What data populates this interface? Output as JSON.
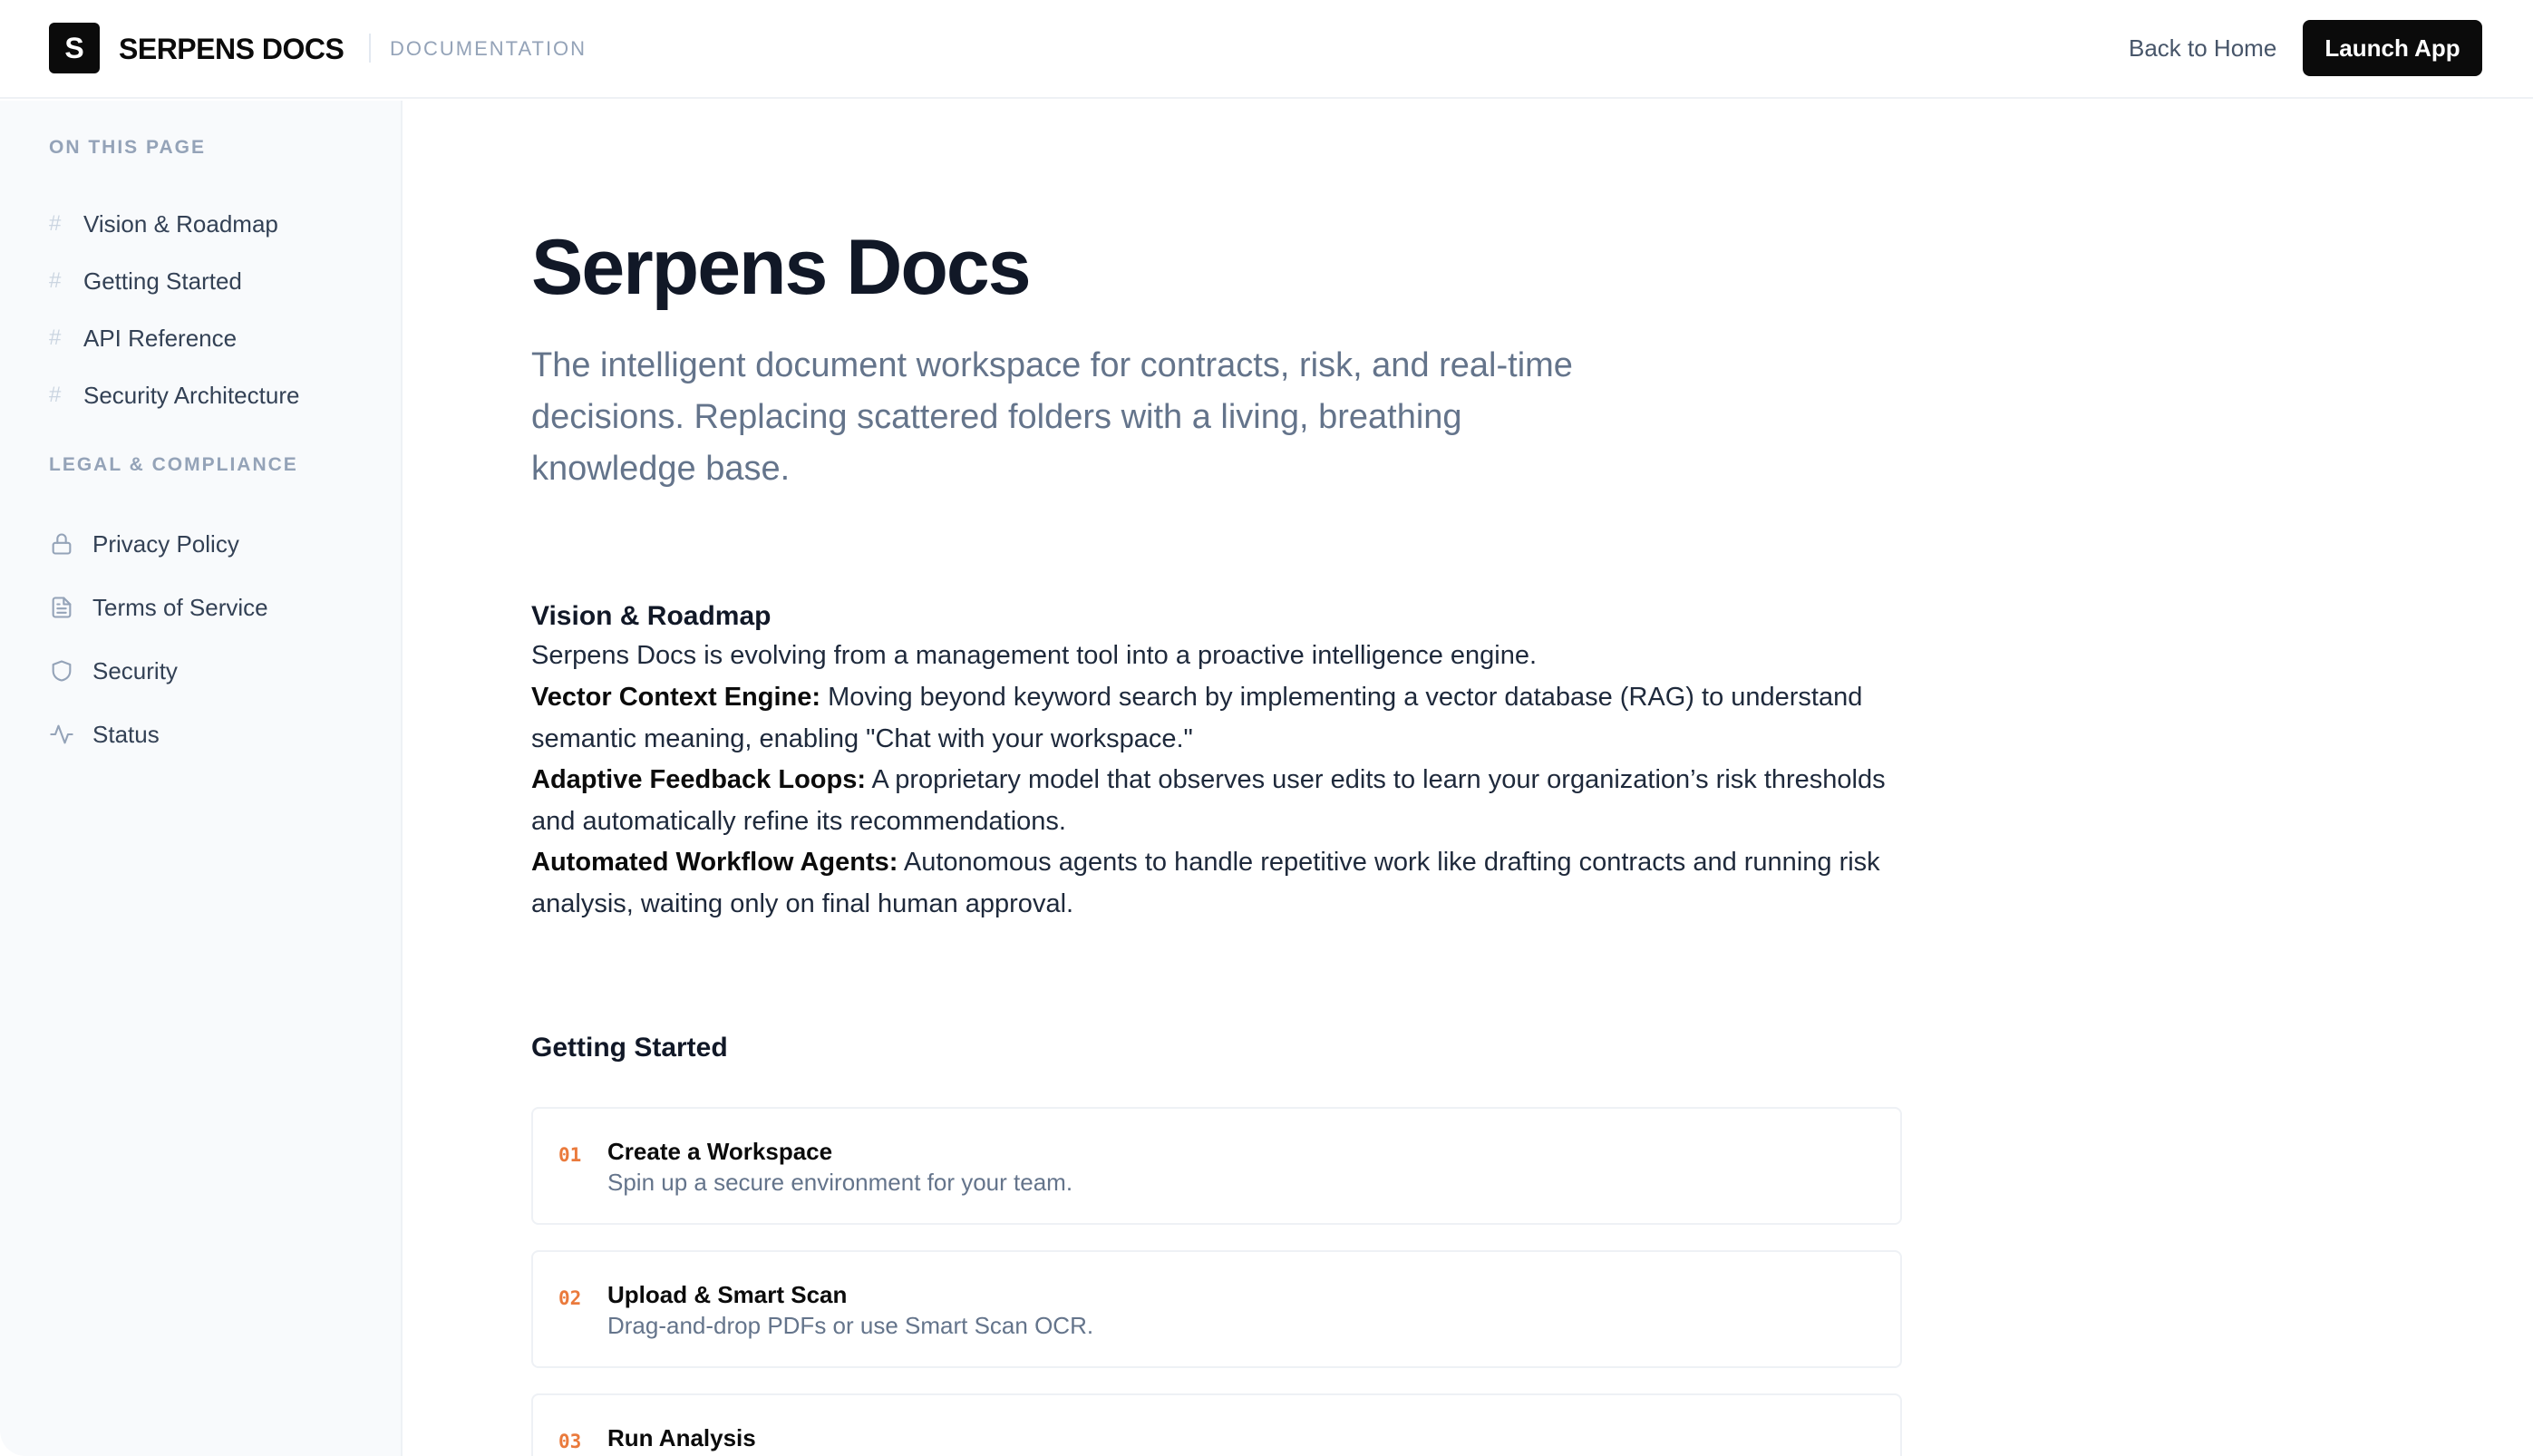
{
  "header": {
    "logo_letter": "S",
    "brand": "SERPENS DOCS",
    "section": "DOCUMENTATION",
    "back_home": "Back to Home",
    "launch_app": "Launch App"
  },
  "sidebar": {
    "on_this_page_heading": "ON THIS PAGE",
    "on_this_page": [
      {
        "label": "Vision & Roadmap"
      },
      {
        "label": "Getting Started"
      },
      {
        "label": "API Reference"
      },
      {
        "label": "Security Architecture"
      }
    ],
    "legal_heading": "LEGAL & COMPLIANCE",
    "legal": [
      {
        "label": "Privacy Policy",
        "icon": "lock-icon"
      },
      {
        "label": "Terms of Service",
        "icon": "document-icon"
      },
      {
        "label": "Security",
        "icon": "shield-icon"
      },
      {
        "label": "Status",
        "icon": "activity-icon"
      }
    ]
  },
  "main": {
    "title": "Serpens Docs",
    "lead": "The intelligent document workspace for contracts, risk, and real-time decisions. Replacing scattered folders with a living, breathing knowledge base.",
    "vision": {
      "heading": "Vision & Roadmap",
      "intro": "Serpens Docs is evolving from a management tool into a proactive intelligence engine.",
      "items": [
        {
          "term": "Vector Context Engine:",
          "text": " Moving beyond keyword search by implementing a vector database (RAG) to understand semantic meaning, enabling \"Chat with your workspace.\""
        },
        {
          "term": "Adaptive Feedback Loops:",
          "text": " A proprietary model that observes user edits to learn your organization’s risk thresholds and automatically refine its recommendations."
        },
        {
          "term": "Automated Workflow Agents:",
          "text": " Autonomous agents to handle repetitive work like drafting contracts and running risk analysis, waiting only on final human approval."
        }
      ]
    },
    "getting_started": {
      "heading": "Getting Started",
      "steps": [
        {
          "num": "01",
          "title": "Create a Workspace",
          "desc": "Spin up a secure environment for your team."
        },
        {
          "num": "02",
          "title": "Upload & Smart Scan",
          "desc": "Drag-and-drop PDFs or use Smart Scan OCR."
        },
        {
          "num": "03",
          "title": "Run Analysis",
          "desc": ""
        }
      ]
    }
  },
  "colors": {
    "accent_step_number": "#ea7a3c",
    "primary_button": "#0b0b0b",
    "sidebar_bg": "#f8fafc"
  }
}
